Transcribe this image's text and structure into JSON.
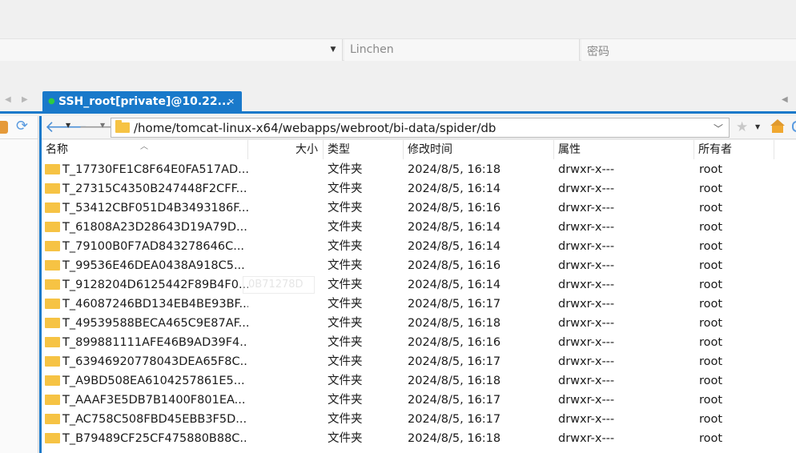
{
  "connection": {
    "username": "Linchen",
    "password_placeholder": "密码"
  },
  "session_tab": {
    "label": "SSH_root[private]@10.22...",
    "close": "×"
  },
  "navigation": {
    "path": "/home/tomcat-linux-x64/webapps/webroot/bi-data/spider/db"
  },
  "file_list": {
    "columns": {
      "name": "名称",
      "size": "大小",
      "type": "类型",
      "mtime": "修改时间",
      "attr": "属性",
      "owner": "所有者"
    },
    "rows": [
      {
        "name": "T_17730FE1C8F64E0FA517AD...",
        "type": "文件夹",
        "mtime": "2024/8/5, 16:18",
        "attr": "drwxr-x---",
        "owner": "root"
      },
      {
        "name": "T_27315C4350B247448F2CFF...",
        "type": "文件夹",
        "mtime": "2024/8/5, 16:14",
        "attr": "drwxr-x---",
        "owner": "root"
      },
      {
        "name": "T_53412CBF051D4B3493186F...",
        "type": "文件夹",
        "mtime": "2024/8/5, 16:16",
        "attr": "drwxr-x---",
        "owner": "root"
      },
      {
        "name": "T_61808A23D28643D19A79D...",
        "type": "文件夹",
        "mtime": "2024/8/5, 16:14",
        "attr": "drwxr-x---",
        "owner": "root"
      },
      {
        "name": "T_79100B0F7AD843278646C...",
        "type": "文件夹",
        "mtime": "2024/8/5, 16:14",
        "attr": "drwxr-x---",
        "owner": "root"
      },
      {
        "name": "T_99536E46DEA0438A918C5...",
        "type": "文件夹",
        "mtime": "2024/8/5, 16:16",
        "attr": "drwxr-x---",
        "owner": "root"
      },
      {
        "name": "T_9128204D6125442F89B4F0...",
        "type": "文件夹",
        "mtime": "2024/8/5, 16:14",
        "attr": "drwxr-x---",
        "owner": "root"
      },
      {
        "name": "T_46087246BD134EB4BE93BF...",
        "type": "文件夹",
        "mtime": "2024/8/5, 16:17",
        "attr": "drwxr-x---",
        "owner": "root"
      },
      {
        "name": "T_49539588BECA465C9E87AF...",
        "type": "文件夹",
        "mtime": "2024/8/5, 16:18",
        "attr": "drwxr-x---",
        "owner": "root"
      },
      {
        "name": "T_899881111AFE46B9AD39F4...",
        "type": "文件夹",
        "mtime": "2024/8/5, 16:16",
        "attr": "drwxr-x---",
        "owner": "root"
      },
      {
        "name": "T_63946920778043DEA65F8C...",
        "type": "文件夹",
        "mtime": "2024/8/5, 16:17",
        "attr": "drwxr-x---",
        "owner": "root"
      },
      {
        "name": "T_A9BD508EA6104257861E5...",
        "type": "文件夹",
        "mtime": "2024/8/5, 16:18",
        "attr": "drwxr-x---",
        "owner": "root"
      },
      {
        "name": "T_AAAF3E5DB7B1400F801EA...",
        "type": "文件夹",
        "mtime": "2024/8/5, 16:17",
        "attr": "drwxr-x---",
        "owner": "root"
      },
      {
        "name": "T_AC758C508FBD45EBB3F5D...",
        "type": "文件夹",
        "mtime": "2024/8/5, 16:17",
        "attr": "drwxr-x---",
        "owner": "root"
      },
      {
        "name": "T_B79489CF25CF475880B88C...",
        "type": "文件夹",
        "mtime": "2024/8/5, 16:18",
        "attr": "drwxr-x---",
        "owner": "root"
      }
    ]
  },
  "overlay": {
    "ghost_text": "0B71278D"
  },
  "icons": {
    "back": "arrow-left-icon",
    "forward": "arrow-right-icon",
    "bookmark": "star-icon",
    "home": "home-icon",
    "folder": "folder-icon"
  },
  "colors": {
    "accent": "#1979ca",
    "folder": "#f6c344",
    "status_online": "#2ecc40"
  }
}
